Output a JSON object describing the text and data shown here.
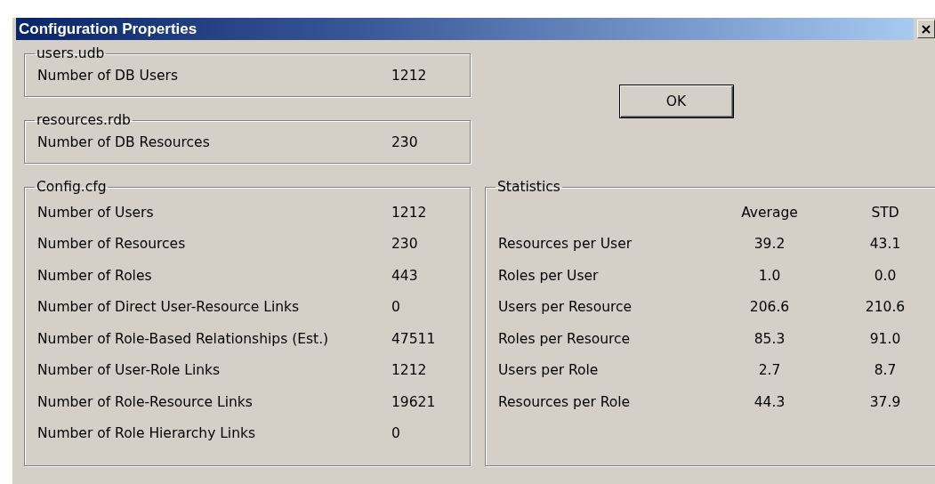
{
  "window": {
    "title": "Configuration Properties"
  },
  "groups": [
    {
      "title": "users.udb",
      "rows": [
        {
          "label": "Number of DB Users",
          "value": "1212"
        }
      ]
    },
    {
      "title": "resources.rdb",
      "rows": [
        {
          "label": "Number of DB Resources",
          "value": "230"
        }
      ]
    },
    {
      "title": "Config.cfg",
      "rows": [
        {
          "label": "Number of Users",
          "value": "1212"
        },
        {
          "label": "Number of Resources",
          "value": "230"
        },
        {
          "label": "Number of Roles",
          "value": "443"
        },
        {
          "label": "Number of Direct User-Resource Links",
          "value": "0"
        },
        {
          "label": "Number of Role-Based Relationships (Est.)",
          "value": "47511"
        },
        {
          "label": "Number of User-Role Links",
          "value": "1212"
        },
        {
          "label": "Number of Role-Resource Links",
          "value": "19621"
        },
        {
          "label": "Number of Role Hierarchy Links",
          "value": "0"
        }
      ]
    }
  ],
  "ok_button": "OK",
  "statistics": {
    "title": "Statistics",
    "columns": [
      "Average",
      "STD"
    ],
    "rows": [
      {
        "label": "Resources per User",
        "average": "39.2",
        "std": "43.1"
      },
      {
        "label": "Roles per User",
        "average": "1.0",
        "std": "0.0"
      },
      {
        "label": "Users per Resource",
        "average": "206.6",
        "std": "210.6"
      },
      {
        "label": "Roles per Resource",
        "average": "85.3",
        "std": "91.0"
      },
      {
        "label": "Users per Role",
        "average": "2.7",
        "std": "8.7"
      },
      {
        "label": "Resources per Role",
        "average": "44.3",
        "std": "37.9"
      }
    ]
  }
}
